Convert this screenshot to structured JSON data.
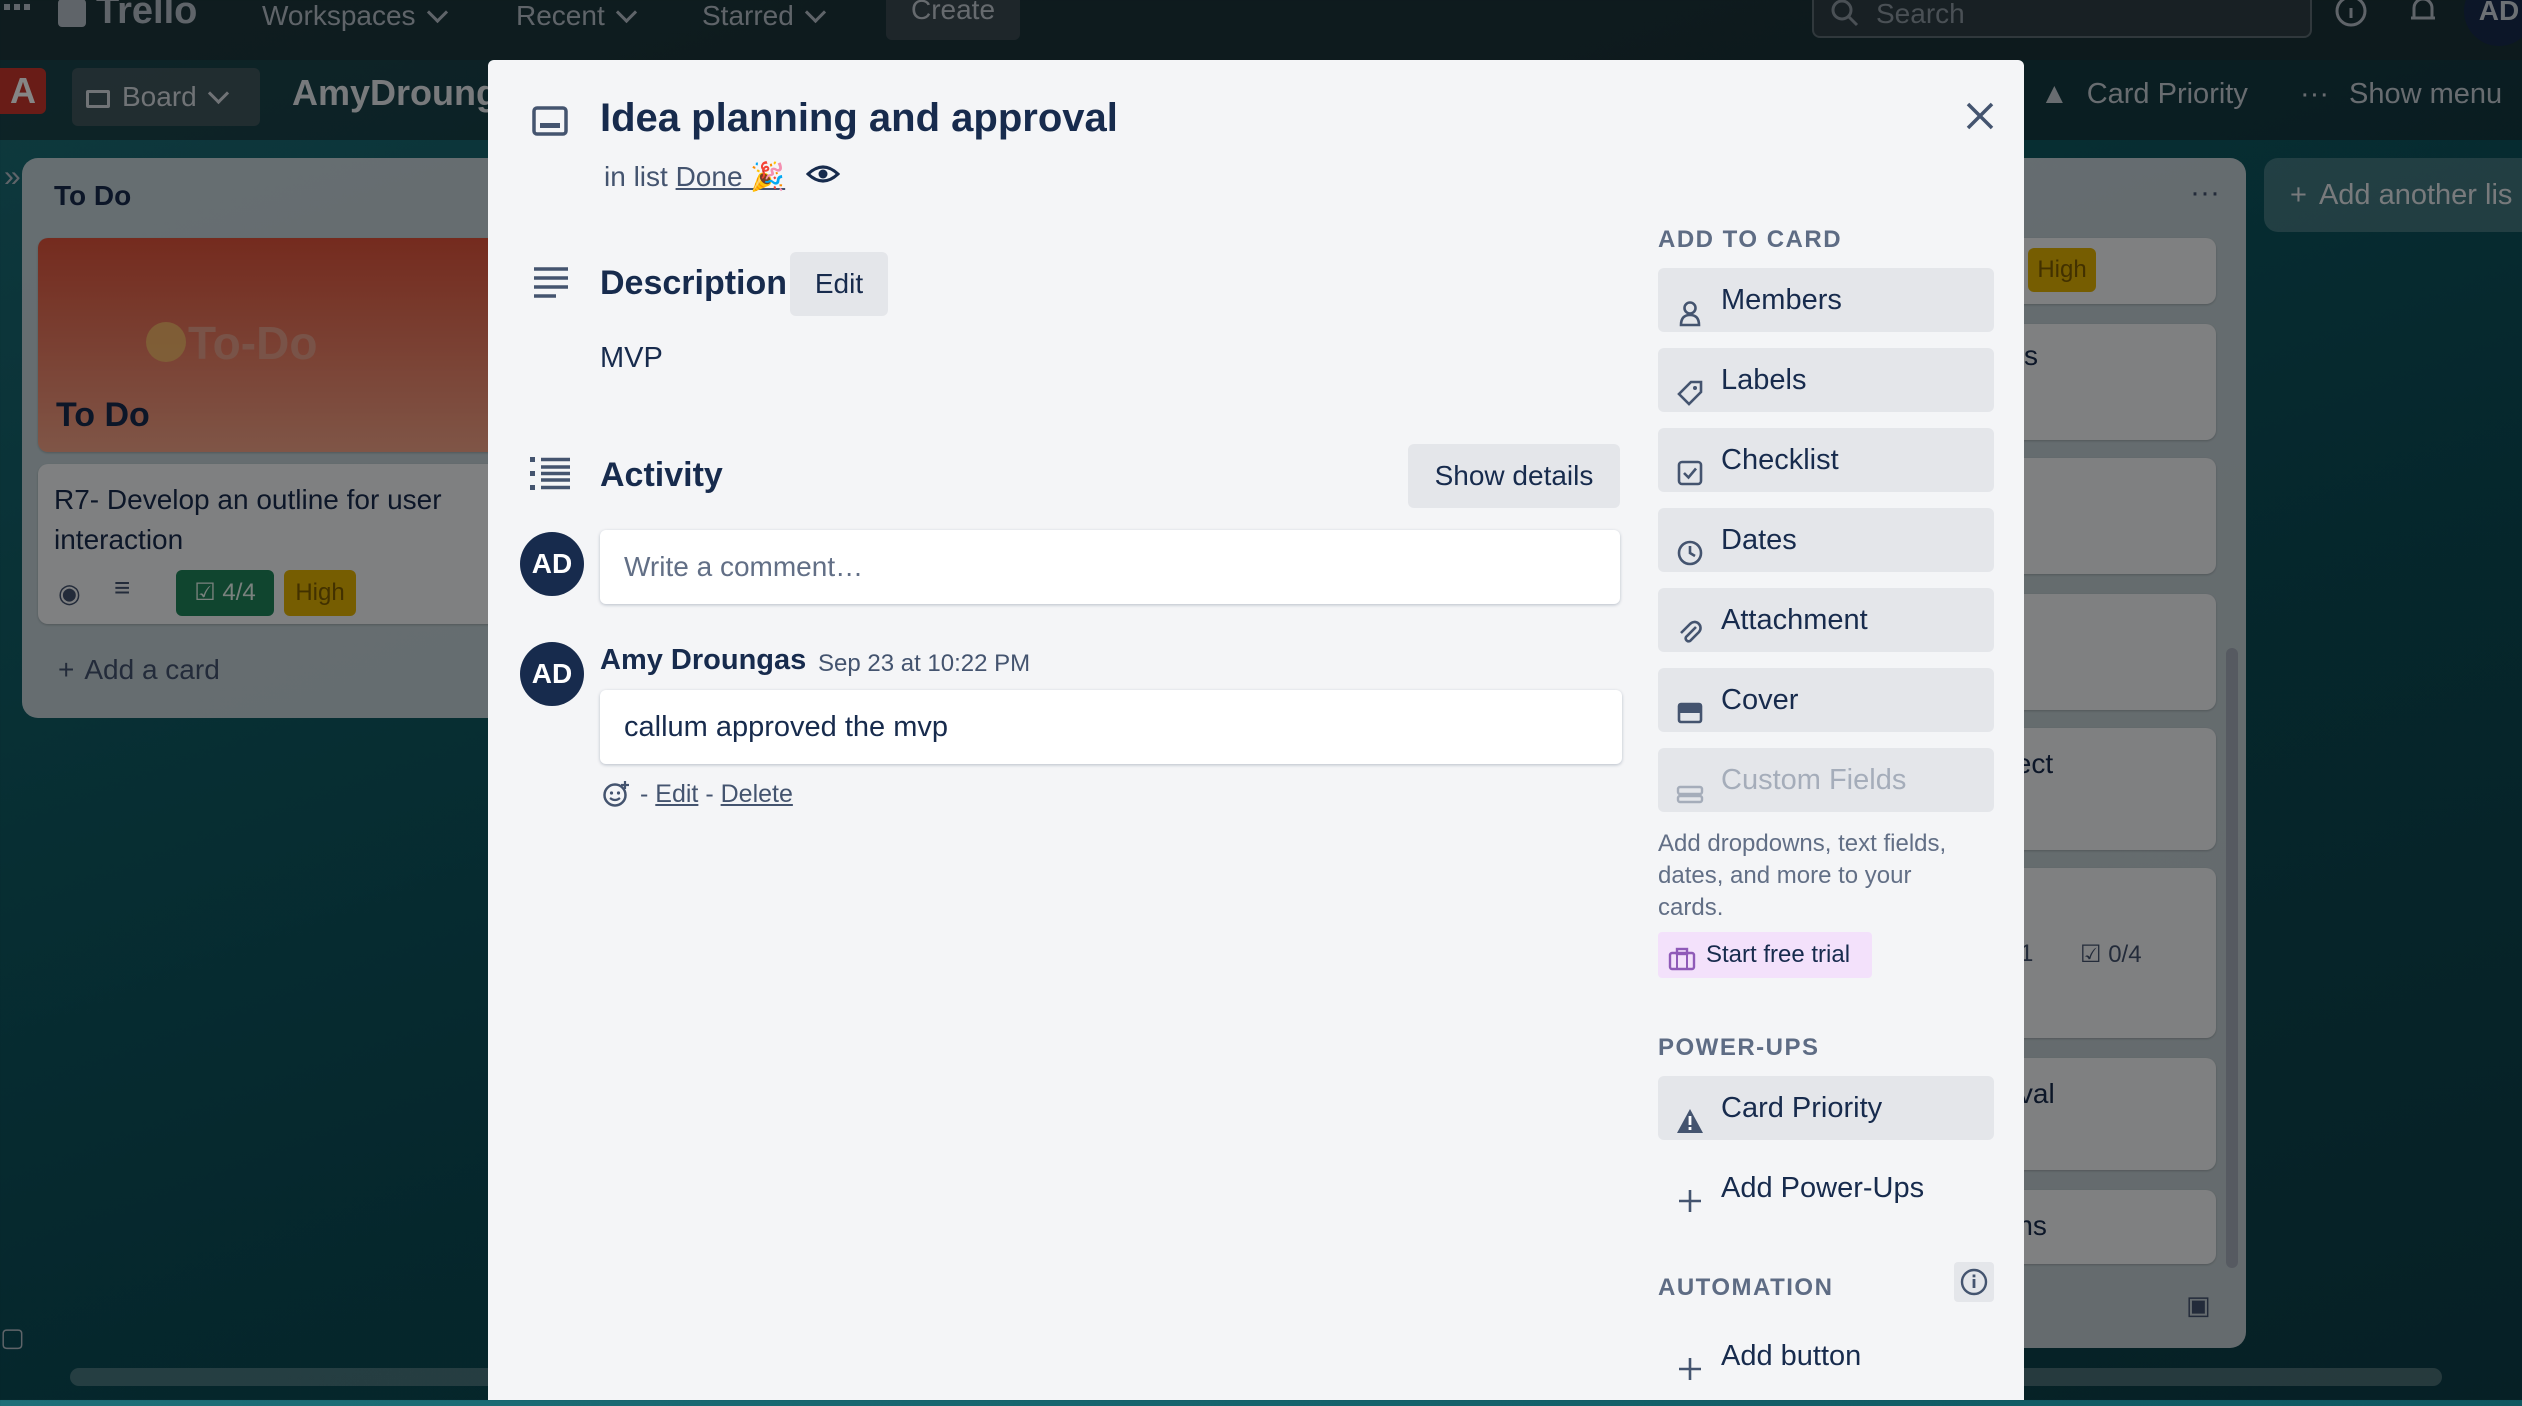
{
  "topnav": {
    "logo": "Trello",
    "workspaces": "Workspaces",
    "recent": "Recent",
    "starred": "Starred",
    "create": "Create",
    "search_placeholder": "Search",
    "user_initials": "AD"
  },
  "boardbar": {
    "workspace_letter": "A",
    "view_label": "Board",
    "board_name": "AmyDroung",
    "card_priority": "Card Priority",
    "show_menu": "Show menu",
    "add_another_list": "Add another lis"
  },
  "background_list": {
    "title": "To Do",
    "cover_title": "To-Do",
    "cover_subtitle": "To Do",
    "card_title": "R7- Develop an outline for user interaction",
    "checklist_badge": "4/4",
    "priority_badge": "High",
    "add_card": "Add a card"
  },
  "background_right": {
    "priority_badge": "High",
    "frag_s": "s",
    "frag_oject": "oject",
    "frag_comments": "1",
    "frag_checklist": "0/4",
    "frag_roval": "roval",
    "frag_ems": "ems"
  },
  "card": {
    "title": "Idea planning and approval",
    "in_list_prefix": "in list",
    "list_name": "Done 🎉",
    "close_label": "×"
  },
  "description": {
    "heading": "Description",
    "edit_label": "Edit",
    "text": "MVP"
  },
  "activity": {
    "heading": "Activity",
    "show_details": "Show details",
    "comment_placeholder": "Write a comment…",
    "user_initials": "AD",
    "comments": [
      {
        "author": "Amy Droungas",
        "timestamp": "Sep 23 at 10:22 PM",
        "text": "callum approved the mvp",
        "initials": "AD",
        "edit": "Edit",
        "delete": "Delete"
      }
    ]
  },
  "sidebar": {
    "add_to_card_heading": "ADD TO CARD",
    "members": "Members",
    "labels": "Labels",
    "checklist": "Checklist",
    "dates": "Dates",
    "attachment": "Attachment",
    "cover": "Cover",
    "custom_fields": "Custom Fields",
    "custom_fields_desc_1": "Add dropdowns, text fields,",
    "custom_fields_desc_2": "dates, and more to your",
    "custom_fields_desc_3": "cards.",
    "start_free_trial": "Start free trial",
    "powerups_heading": "POWER-UPS",
    "card_priority": "Card Priority",
    "add_powerups": "Add Power-Ups",
    "automation_heading": "AUTOMATION",
    "add_button": "Add button"
  },
  "colors": {
    "green_badge": "#4bce97",
    "yellow_badge": "#e2b203",
    "trial_bg": "#f3e1fb",
    "link": "#172b4d"
  }
}
